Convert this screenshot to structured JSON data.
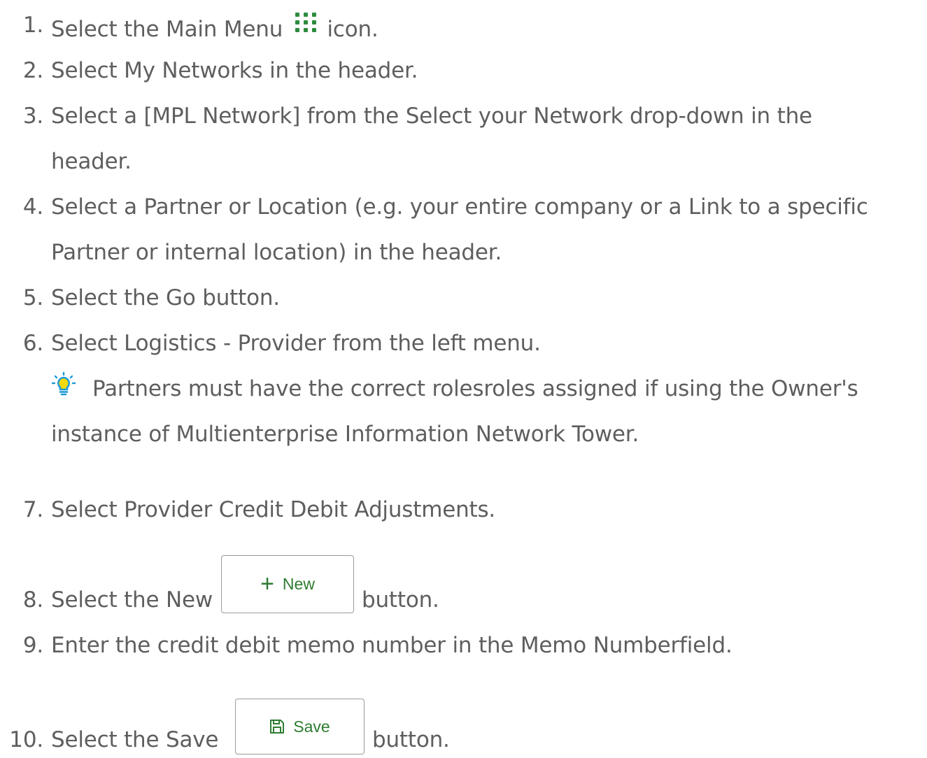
{
  "steps": [
    {
      "num": "1.",
      "before": "Select the Main Menu ",
      "after": " icon."
    },
    {
      "num": "2.",
      "text": "Select My Networks in the header."
    },
    {
      "num": "3.",
      "text": "Select a [MPL Network] from the Select your Network drop-down in the",
      "cont": "header."
    },
    {
      "num": "4.",
      "text": "Select a Partner or Location (e.g. your entire company or a Link to a specific",
      "cont": "Partner or internal location) in the header."
    },
    {
      "num": "5.",
      "text": "Select the Go button."
    },
    {
      "num": "6.",
      "text": " Select Logistics - Provider from the left menu."
    },
    {
      "num": "7.",
      "text": "Select Provider Credit Debit Adjustments."
    },
    {
      "num": "8.",
      "before": "Select the New ",
      "after": "button."
    },
    {
      "num": "9.",
      "text": "Enter the credit debit memo number in the Memo Numberfield."
    },
    {
      "num": "10.",
      "before": "Select the Save ",
      "after": "button."
    }
  ],
  "tip": {
    "line1": "Partners must have the correct rolesroles assigned if using the Owner's",
    "line2": "instance of Multienterprise Information Network Tower."
  },
  "buttons": {
    "new_label": "New",
    "save_label": "Save"
  },
  "icons": {
    "menu": "grid-dots-icon",
    "tip": "lightbulb-icon",
    "new": "plus-icon",
    "save": "save-icon"
  },
  "colors": {
    "text": "#5e5e5e",
    "accent_green": "#2e7d32",
    "bulb_blue": "#1e9bd7",
    "bulb_yellow": "#f5d90a"
  }
}
